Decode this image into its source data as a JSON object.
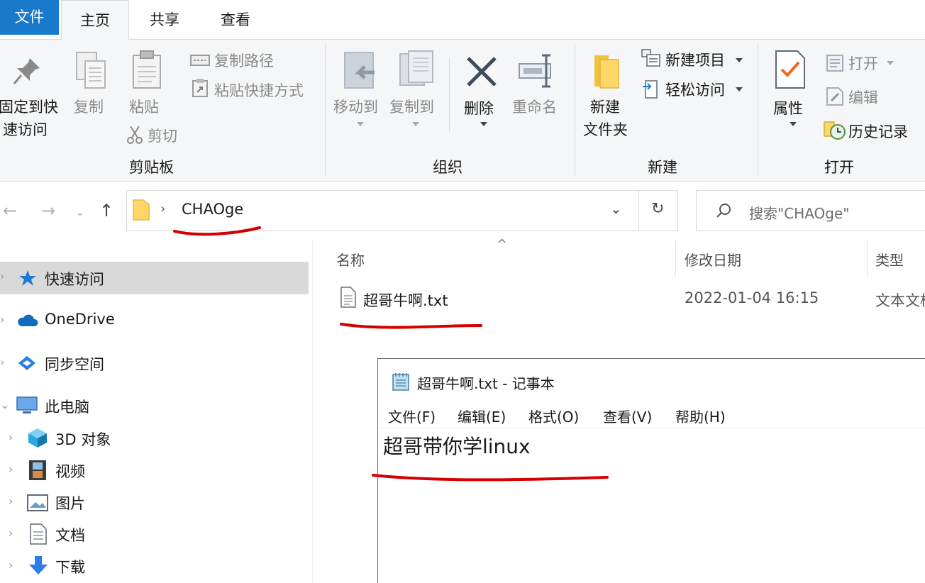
{
  "ribbon": {
    "tabs": {
      "file": "文件",
      "home": "主页",
      "share": "共享",
      "view": "查看"
    },
    "clipboard": {
      "pin_line1": "固定到快",
      "pin_line2": "速访问",
      "copy": "复制",
      "paste": "粘贴",
      "copy_path": "复制路径",
      "paste_shortcut": "粘贴快捷方式",
      "cut": "剪切",
      "group": "剪贴板"
    },
    "organize": {
      "move_to": "移动到",
      "copy_to": "复制到",
      "delete": "删除",
      "rename": "重命名",
      "group": "组织"
    },
    "new": {
      "new_folder_line1": "新建",
      "new_folder_line2": "文件夹",
      "new_item": "新建项目",
      "easy_access": "轻松访问",
      "group": "新建"
    },
    "open": {
      "properties": "属性",
      "open": "打开",
      "edit": "编辑",
      "history": "历史记录",
      "group": "打开"
    }
  },
  "address": {
    "path": "CHAOge",
    "search_placeholder": "搜索\"CHAOge\""
  },
  "nav_pane": {
    "quick_access": "快速访问",
    "onedrive": "OneDrive",
    "sync_space": "同步空间",
    "this_pc": "此电脑",
    "objects_3d": "3D 对象",
    "videos": "视频",
    "pictures": "图片",
    "documents": "文档",
    "downloads": "下载"
  },
  "file_list": {
    "columns": {
      "name": "名称",
      "modified": "修改日期",
      "type": "类型"
    },
    "files": [
      {
        "name": "超哥牛啊.txt",
        "modified": "2022-01-04 16:15",
        "type": "文本文档"
      }
    ]
  },
  "notepad": {
    "title": "超哥牛啊.txt - 记事本",
    "menu": {
      "file": "文件(F)",
      "edit": "编辑(E)",
      "format": "格式(O)",
      "view": "查看(V)",
      "help": "帮助(H)"
    },
    "content": "超哥带你学linux"
  },
  "colors": {
    "accent": "#1979ca",
    "annotation_red": "#d40000",
    "selected_bg": "#d9d9d9"
  }
}
